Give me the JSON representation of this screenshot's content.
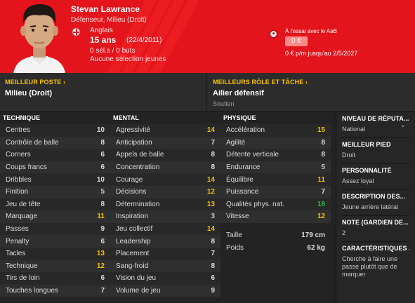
{
  "player": {
    "name": "Stevan Lawrance",
    "position": "Défenseur, Milieu (Droit)",
    "nationality": "Anglais",
    "age": "15 ans",
    "dob": "(22/4/2011)",
    "caps": "0 sél.s / 0 buts",
    "intl": "Aucune sélection jeunes"
  },
  "contract": {
    "trial": "À l'essai avec le AaB",
    "fee": "0 €",
    "wage": "0 € p/m jusqu'au 2/5/2027"
  },
  "best_position": {
    "title": "MEILLEUR POSTE",
    "value": "Milieu (Droit)"
  },
  "best_role": {
    "title": "MEILLEURS RÔLE ET TÂCHE",
    "value": "Ailier défensif",
    "duty": "Soutien"
  },
  "technical": {
    "title": "TECHNIQUE",
    "rows": [
      {
        "label": "Centres",
        "value": "10",
        "tier": "w"
      },
      {
        "label": "Contrôle de balle",
        "value": "8",
        "tier": "w"
      },
      {
        "label": "Corners",
        "value": "6",
        "tier": "w"
      },
      {
        "label": "Coups francs",
        "value": "6",
        "tier": "w"
      },
      {
        "label": "Dribbles",
        "value": "10",
        "tier": "w"
      },
      {
        "label": "Finition",
        "value": "5",
        "tier": "d"
      },
      {
        "label": "Jeu de tête",
        "value": "8",
        "tier": "w"
      },
      {
        "label": "Marquage",
        "value": "11",
        "tier": "y"
      },
      {
        "label": "Passes",
        "value": "9",
        "tier": "w"
      },
      {
        "label": "Penalty",
        "value": "6",
        "tier": "w"
      },
      {
        "label": "Tacles",
        "value": "13",
        "tier": "y"
      },
      {
        "label": "Technique",
        "value": "12",
        "tier": "y"
      },
      {
        "label": "Tirs de loin",
        "value": "6",
        "tier": "w"
      },
      {
        "label": "Touches longues",
        "value": "7",
        "tier": "w"
      }
    ]
  },
  "mental": {
    "title": "MENTAL",
    "rows": [
      {
        "label": "Agressivité",
        "value": "14",
        "tier": "y"
      },
      {
        "label": "Anticipation",
        "value": "7",
        "tier": "w"
      },
      {
        "label": "Appels de balle",
        "value": "8",
        "tier": "w"
      },
      {
        "label": "Concentration",
        "value": "8",
        "tier": "w"
      },
      {
        "label": "Courage",
        "value": "14",
        "tier": "y"
      },
      {
        "label": "Décisions",
        "value": "12",
        "tier": "y"
      },
      {
        "label": "Détermination",
        "value": "13",
        "tier": "y"
      },
      {
        "label": "Inspiration",
        "value": "3",
        "tier": "d"
      },
      {
        "label": "Jeu collectif",
        "value": "14",
        "tier": "y"
      },
      {
        "label": "Leadership",
        "value": "8",
        "tier": "w"
      },
      {
        "label": "Placement",
        "value": "7",
        "tier": "w"
      },
      {
        "label": "Sang-froid",
        "value": "8",
        "tier": "w"
      },
      {
        "label": "Vision du jeu",
        "value": "6",
        "tier": "w"
      },
      {
        "label": "Volume de jeu",
        "value": "9",
        "tier": "w"
      }
    ]
  },
  "physical": {
    "title": "PHYSIQUE",
    "rows": [
      {
        "label": "Accélération",
        "value": "15",
        "tier": "y"
      },
      {
        "label": "Agilité",
        "value": "8",
        "tier": "w"
      },
      {
        "label": "Détente verticale",
        "value": "8",
        "tier": "w"
      },
      {
        "label": "Endurance",
        "value": "5",
        "tier": "d"
      },
      {
        "label": "Équilibre",
        "value": "11",
        "tier": "y"
      },
      {
        "label": "Puissance",
        "value": "7",
        "tier": "w"
      },
      {
        "label": "Qualités phys. nat.",
        "value": "18",
        "tier": "g"
      },
      {
        "label": "Vitesse",
        "value": "12",
        "tier": "y"
      }
    ],
    "extra": [
      {
        "label": "Taille",
        "value": "179 cm"
      },
      {
        "label": "Poids",
        "value": "62 kg"
      }
    ]
  },
  "side": [
    {
      "title": "NIVEAU DE RÉPUTA...",
      "value": "National"
    },
    {
      "title": "MEILLEUR PIED",
      "value": "Droit"
    },
    {
      "title": "PERSONNALITÉ",
      "value": "Assez loyal"
    },
    {
      "title": "DESCRIPTION DES...",
      "value": "Jeune arrière latéral"
    },
    {
      "title": "NOTE (GARDIEN DE...",
      "value": "2"
    },
    {
      "title": "CARACTÉRISTIQUES J",
      "value": "Cherche à faire une passe plutôt que de marquer"
    }
  ],
  "colors": {
    "header": "#e3141c",
    "accent": "#f5c000",
    "good": "#26c34a",
    "bg": "#232323"
  }
}
